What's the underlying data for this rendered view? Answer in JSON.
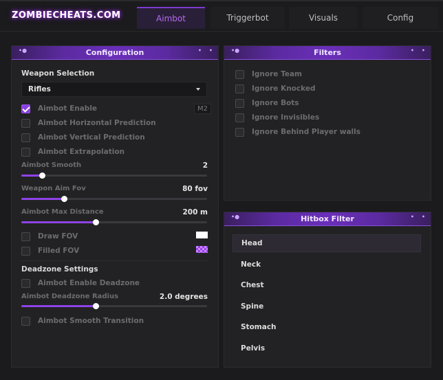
{
  "app": {
    "logo": "ZOMBIECHEATS.COM"
  },
  "tabs": [
    {
      "label": "Aimbot",
      "active": true
    },
    {
      "label": "Triggerbot",
      "active": false
    },
    {
      "label": "Visuals",
      "active": false
    },
    {
      "label": "Config",
      "active": false
    }
  ],
  "config": {
    "title": "Configuration",
    "weapon_selection_label": "Weapon Selection",
    "weapon_value": "Rifles",
    "checkboxes": [
      {
        "label": "Aimbot Enable",
        "checked": true,
        "key": "M2"
      },
      {
        "label": "Aimbot Horizontal Prediction",
        "checked": false
      },
      {
        "label": "Aimbot Vertical Prediction",
        "checked": false
      },
      {
        "label": "Aimbot Extrapolation",
        "checked": false
      }
    ],
    "sliders": [
      {
        "label": "Aimbot Smooth",
        "value": "2",
        "fraction": 0.11
      },
      {
        "label": "Weapon Aim Fov",
        "value": "80 fov",
        "fraction": 0.23
      },
      {
        "label": "Aimbot Max Distance",
        "value": "200 m",
        "fraction": 0.4
      }
    ],
    "fov": [
      {
        "label": "Draw FOV",
        "checked": false,
        "color": "#ffffff"
      },
      {
        "label": "Filled FOV",
        "checked": false,
        "color": "#9b3fe8"
      }
    ],
    "deadzone": {
      "title": "Deadzone Settings",
      "enable_label": "Aimbot Enable Deadzone",
      "radius_label": "Aimbot Deadzone Radius",
      "radius_value": "2.0 degrees",
      "radius_fraction": 0.4,
      "smooth_transition_label": "Aimbot Smooth Transition"
    }
  },
  "filters": {
    "title": "Filters",
    "items": [
      {
        "label": "Ignore Team",
        "checked": false
      },
      {
        "label": "Ignore Knocked",
        "checked": false
      },
      {
        "label": "Ignore Bots",
        "checked": false
      },
      {
        "label": "Ignore Invisibles",
        "checked": false
      },
      {
        "label": "Ignore Behind Player walls",
        "checked": false
      }
    ]
  },
  "hitbox": {
    "title": "Hitbox Filter",
    "items": [
      {
        "label": "Head",
        "selected": true
      },
      {
        "label": "Neck",
        "selected": false
      },
      {
        "label": "Chest",
        "selected": false
      },
      {
        "label": "Spine",
        "selected": false
      },
      {
        "label": "Stomach",
        "selected": false
      },
      {
        "label": "Pelvis",
        "selected": false
      }
    ]
  },
  "colors": {
    "accent": "#8f42e8",
    "header": "#5b2aa0",
    "background": "#1b1b1d"
  }
}
